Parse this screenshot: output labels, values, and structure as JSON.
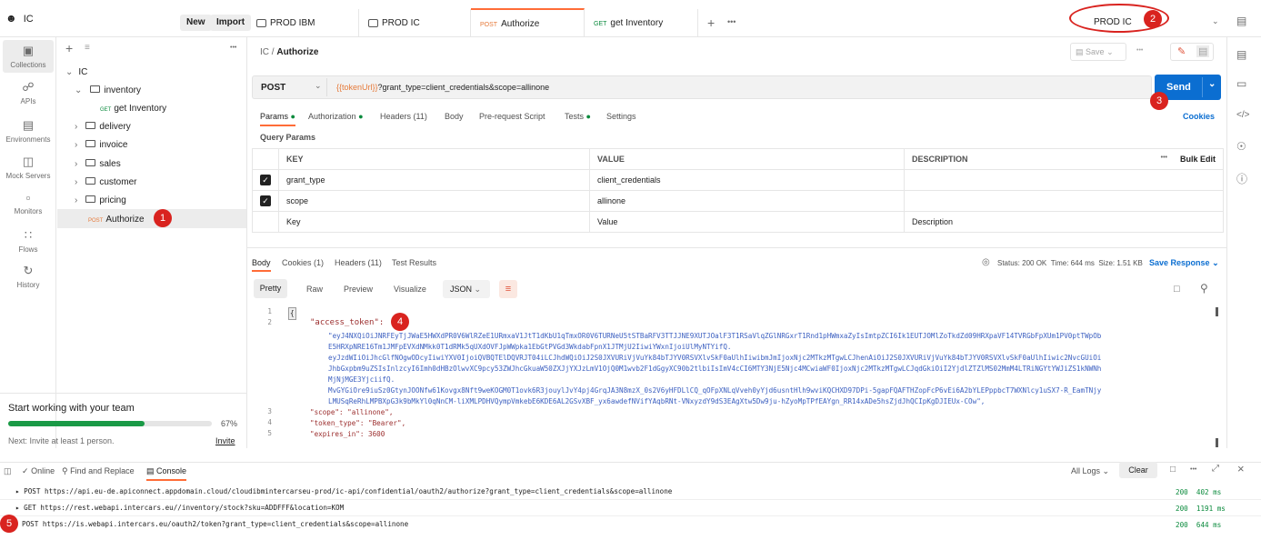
{
  "workspace": {
    "name": "IC",
    "new_label": "New",
    "import_label": "Import"
  },
  "tabs": [
    {
      "method": "",
      "label": "PROD IBM"
    },
    {
      "method": "",
      "label": "PROD IC"
    },
    {
      "method": "POST",
      "label": "Authorize"
    },
    {
      "method": "GET",
      "label": "get Inventory"
    }
  ],
  "environment": {
    "selected": "PROD IC"
  },
  "rail": [
    {
      "label": "Collections"
    },
    {
      "label": "APIs"
    },
    {
      "label": "Environments"
    },
    {
      "label": "Mock Servers"
    },
    {
      "label": "Monitors"
    },
    {
      "label": "Flows"
    },
    {
      "label": "History"
    }
  ],
  "collection": {
    "name": "IC",
    "items": [
      {
        "label": "inventory",
        "type": "folder"
      },
      {
        "label": "get Inventory",
        "type": "request",
        "method": "GET"
      },
      {
        "label": "delivery",
        "type": "folder"
      },
      {
        "label": "invoice",
        "type": "folder"
      },
      {
        "label": "sales",
        "type": "folder"
      },
      {
        "label": "customer",
        "type": "folder"
      },
      {
        "label": "pricing",
        "type": "folder"
      },
      {
        "label": "Authorize",
        "type": "request",
        "method": "POST"
      }
    ]
  },
  "onboarding": {
    "title": "Start working with your team",
    "progress_label": "67%",
    "progress": 0.67,
    "next": "Next: Invite at least 1 person.",
    "invite": "Invite"
  },
  "request": {
    "breadcrumb_parent": "IC",
    "breadcrumb_sep": "/",
    "breadcrumb_current": "Authorize",
    "save_label": "Save",
    "method": "POST",
    "url_var": "{{tokenUrl}}",
    "url_rest": "?grant_type=client_credentials&scope=allinone",
    "send_label": "Send",
    "tabs": [
      "Params",
      "Authorization",
      "Headers (11)",
      "Body",
      "Pre-request Script",
      "Tests",
      "Settings"
    ],
    "cookies_label": "Cookies",
    "query_params_label": "Query Params",
    "columns": [
      "KEY",
      "VALUE",
      "DESCRIPTION"
    ],
    "bulk_edit": "Bulk Edit",
    "params": [
      {
        "key": "grant_type",
        "value": "client_credentials"
      },
      {
        "key": "scope",
        "value": "allinone"
      }
    ],
    "placeholder_key": "Key",
    "placeholder_value": "Value",
    "placeholder_desc": "Description"
  },
  "response": {
    "tabs": [
      "Body",
      "Cookies (1)",
      "Headers (11)",
      "Test Results"
    ],
    "status": "Status: 200 OK",
    "time": "Time: 644 ms",
    "size": "Size: 1.51 KB",
    "save_response": "Save Response",
    "view_tabs": [
      "Pretty",
      "Raw",
      "Preview",
      "Visualize"
    ],
    "format": "JSON",
    "lines": [
      {
        "n": "1",
        "text": "{"
      },
      {
        "n": "2",
        "text": "\"access_token\": "
      },
      {
        "n": "",
        "text": "\"eyJ4NXQiOiJNRFEyTjJWaE5HWXdPR0V6WlRZeE1URmxaV1JtT1dKbU1qTmxOR0V6TURNeU5tSTBaRFV3TTJJNE9XUTJOalF3T1RSaVlqZGlNRGxrT1Rnd1pHWmxaZyIsImtpZCI6Ik1EUTJOMlZoTkdZd09HRXpaVF14TVRGbFpXUm1PV0ptTWpOb"
      },
      {
        "n": "",
        "text": "E5HRXpNRE16Tm1JMFpEVXdNMkk0T1dRMk5qUXdOVFJpWWpka1EbGtPVGd3WkdabFpnX1JTMjU2IiwiYWxnIjoiUlMyNTYifQ."
      },
      {
        "n": "",
        "text": "eyJzdWIiOiJhcGlfNOgwODcyIiwiYXV0IjoiQVBQTElDQVRJT04iLCJhdWQiOiJ2S0JXVURiVjVuYk84bTJYV0RSVXlvSkF0aUlhIiwibmJmIjoxNjc2MTkzMTgwLCJhenAiOiJ2S0JXVURiVjVuYk84bTJYV0RSVXlvSkF0aUlhIiwic2NvcGUiOi"
      },
      {
        "n": "",
        "text": "JhbGxpbm9uZSIsInlzcyI6Imh0dHBzOlwvXC9pcy53ZWJhcGkuaW50ZXJjYXJzLmV1OjQ0M1wvb2F1dGgyXC90b2tlbiIsImV4cCI6MTY3NjE5Njc4MCwiaWF0IjoxNjc2MTkzMTgwLCJqdGkiOiI2YjdlZTZlMS02MmM4LTRiNGYtYWJiZS1kNWNh"
      },
      {
        "n": "",
        "text": "MjNjMGE3YjciifQ."
      },
      {
        "n": "",
        "text": "MvGYGiOre9iuSz0GtynJOONfw61Kovgx8Nft9weKOGM0T1ovk6R3jouylJvY4pj4GrqJA3N8mzX_0s2V6yHFDLlCQ_qOFpXNLqVveh0yYjd6usntHlh9wviKQCHXD97DPi-5gapFQAFTHZopFcP6vEi6A2bYLEPppbcT7WXNlcy1uSX7-R_EamTNjy"
      },
      {
        "n": "",
        "text": "LMUSqReRhLMPBXpG3k9bMkYl0qNnCM-liXMLPDHVQympVmkebE6KDE6AL2GSvXBF_yx6awdefNVifYAqbRNt-VNxyzdY9dS3EAgXtw5Dw9ju-hZyoMpTPfEAYgn_RR14xADe5hsZjdJhQCIpKgDJIEUx-COw\","
      },
      {
        "n": "3",
        "text": "\"scope\": \"allinone\","
      },
      {
        "n": "4",
        "text": "\"token_type\": \"Bearer\","
      },
      {
        "n": "5",
        "text": "\"expires_in\": 3600"
      }
    ]
  },
  "console": {
    "online": "Online",
    "find_replace": "Find and Replace",
    "console_label": "Console",
    "all_logs": "All Logs",
    "clear": "Clear",
    "logs": [
      {
        "text": "▸ POST https://api.eu-de.apiconnect.appdomain.cloud/cloudibmintercarseu-prod/ic-api/confidential/oauth2/authorize?grant_type=client_credentials&scope=allinone",
        "status": "200",
        "time": "402 ms"
      },
      {
        "text": "▸ GET https://rest.webapi.intercars.eu//inventory/stock?sku=ADDFFF&location=KOM",
        "status": "200",
        "time": "1191 ms"
      },
      {
        "text": "POST https://is.webapi.intercars.eu/oauth2/token?grant_type=client_credentials&scope=allinone",
        "status": "200",
        "time": "644 ms"
      }
    ]
  },
  "badges": [
    "1",
    "2",
    "3",
    "4",
    "5"
  ]
}
